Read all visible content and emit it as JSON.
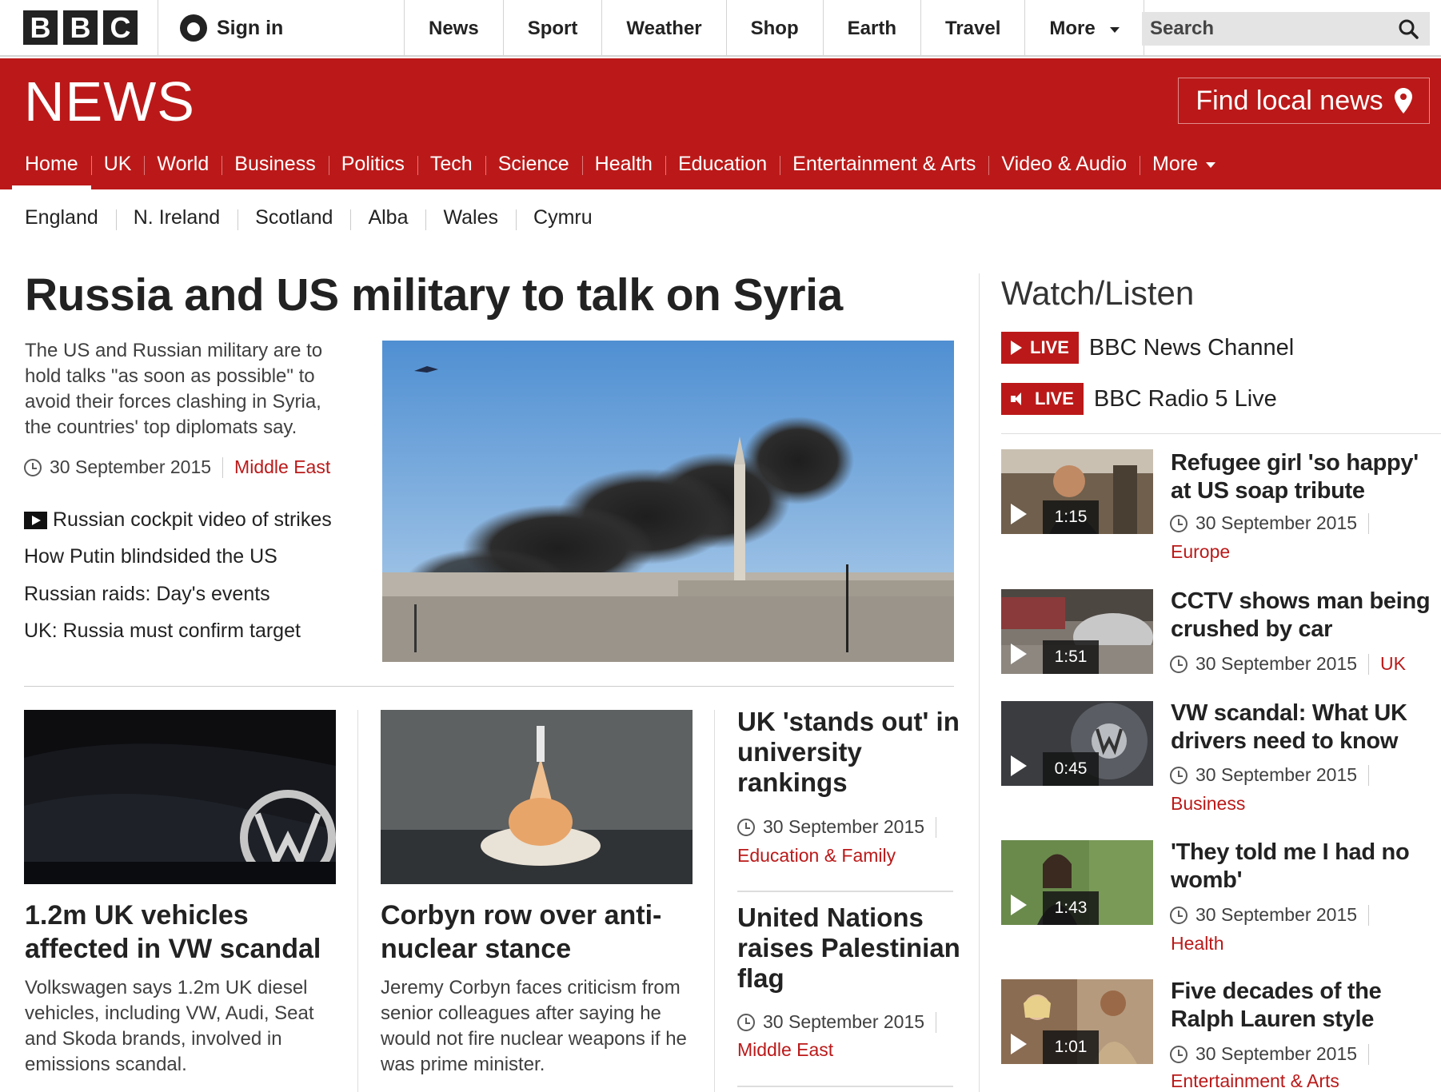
{
  "global": {
    "logo": [
      "B",
      "B",
      "C"
    ],
    "sign_in": "Sign in",
    "nav": [
      "News",
      "Sport",
      "Weather",
      "Shop",
      "Earth",
      "Travel",
      "More"
    ],
    "search_placeholder": "Search"
  },
  "brand": {
    "title": "NEWS",
    "find_local": "Find local news",
    "accent": "#bb1919"
  },
  "section_nav": [
    "Home",
    "UK",
    "World",
    "Business",
    "Politics",
    "Tech",
    "Science",
    "Health",
    "Education",
    "Entertainment & Arts",
    "Video & Audio",
    "More"
  ],
  "sub_nav": [
    "England",
    "N. Ireland",
    "Scotland",
    "Alba",
    "Wales",
    "Cymru"
  ],
  "lead": {
    "title": "Russia and US military to talk on Syria",
    "summary": "The US and Russian military are to hold talks \"as soon as possible\" to avoid their forces clashing in Syria, the countries' top diplomats say.",
    "date": "30 September 2015",
    "tag": "Middle East",
    "related": [
      "Russian cockpit video of strikes",
      "How Putin blindsided the US",
      "Russian raids: Day's events",
      "UK: Russia must confirm target"
    ]
  },
  "cards": [
    {
      "title": "1.2m UK vehicles affected in VW scandal",
      "summary": "Volkswagen says 1.2m UK diesel vehicles, including VW, Audi, Seat and Skoda brands, involved in emissions scandal."
    },
    {
      "title": "Corbyn row over anti-nuclear stance",
      "summary": "Jeremy Corbyn faces criticism from senior colleagues after saying he would not fire nuclear weapons if he was prime minister."
    }
  ],
  "small_stories": [
    {
      "title": "UK 'stands out' in university rankings",
      "date": "30 September 2015",
      "tag": "Education & Family"
    },
    {
      "title": "United Nations raises Palestinian flag",
      "date": "30 September 2015",
      "tag": "Middle East"
    }
  ],
  "watch_listen": {
    "title": "Watch/Listen",
    "live_label": "LIVE",
    "live": [
      "BBC News Channel",
      "BBC Radio 5 Live"
    ],
    "videos": [
      {
        "title": "Refugee girl 'so happy' at US soap tribute",
        "duration": "1:15",
        "date": "30 September 2015",
        "tag": "Europe"
      },
      {
        "title": "CCTV shows man being crushed by car",
        "duration": "1:51",
        "date": "30 September 2015",
        "tag": "UK"
      },
      {
        "title": "VW scandal: What UK drivers need to know",
        "duration": "0:45",
        "date": "30 September 2015",
        "tag": "Business"
      },
      {
        "title": "'They told me I had no womb'",
        "duration": "1:43",
        "date": "30 September 2015",
        "tag": "Health"
      },
      {
        "title": "Five decades of the Ralph Lauren style",
        "duration": "1:01",
        "date": "30 September 2015",
        "tag": "Entertainment & Arts"
      }
    ]
  }
}
